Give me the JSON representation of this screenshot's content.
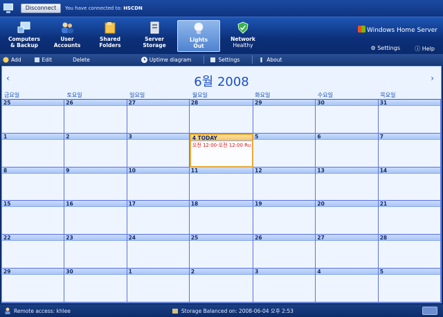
{
  "connection": {
    "disconnect_label": "Disconnect",
    "message_prefix": "You have connected to:",
    "server_name": "HSCDN"
  },
  "nav": {
    "tabs": [
      {
        "line1": "Computers",
        "line2": "& Backup",
        "icon": "computers-icon"
      },
      {
        "line1": "User",
        "line2": "Accounts",
        "icon": "users-icon"
      },
      {
        "line1": "Shared",
        "line2": "Folders",
        "icon": "folders-icon"
      },
      {
        "line1": "Server",
        "line2": "Storage",
        "icon": "storage-icon"
      },
      {
        "line1": "Lights",
        "line2": "Out",
        "icon": "bulb-icon",
        "active": true
      },
      {
        "line1": "Network",
        "line2": "Healthy",
        "icon": "shield-icon"
      }
    ],
    "brand": "Windows Home Server",
    "settings_label": "Settings",
    "help_label": "Help"
  },
  "toolbar": {
    "add_label": "Add",
    "edit_label": "Edit",
    "delete_label": "Delete",
    "uptime_label": "Uptime diagram",
    "settings_label": "Settings",
    "about_label": "About"
  },
  "calendar": {
    "month_title": "6월 2008",
    "prev_symbol": "‹",
    "next_symbol": "›",
    "weekdays": [
      "금요일",
      "토요일",
      "일요일",
      "월요일",
      "화요일",
      "수요일",
      "목요일"
    ],
    "days": [
      "25",
      "26",
      "27",
      "28",
      "29",
      "30",
      "31",
      "1",
      "2",
      "3",
      "4 TODAY",
      "5",
      "6",
      "7",
      "8",
      "9",
      "10",
      "11",
      "12",
      "13",
      "14",
      "15",
      "16",
      "17",
      "18",
      "19",
      "20",
      "21",
      "22",
      "23",
      "24",
      "25",
      "26",
      "27",
      "28",
      "29",
      "30",
      "1",
      "2",
      "3",
      "4",
      "5"
    ],
    "today_index": 10,
    "today_event": "오전 12:00-오전 12:00 Ru"
  },
  "status": {
    "remote_access": "Remote access: khlee",
    "storage": "Storage Balanced on: 2008-06-04 오후 2:53"
  },
  "colors": {
    "accent": "#1b4ec0",
    "grid_line": "#5a6fe0",
    "today_border": "#e8a83a",
    "event_text": "#dd1111"
  }
}
